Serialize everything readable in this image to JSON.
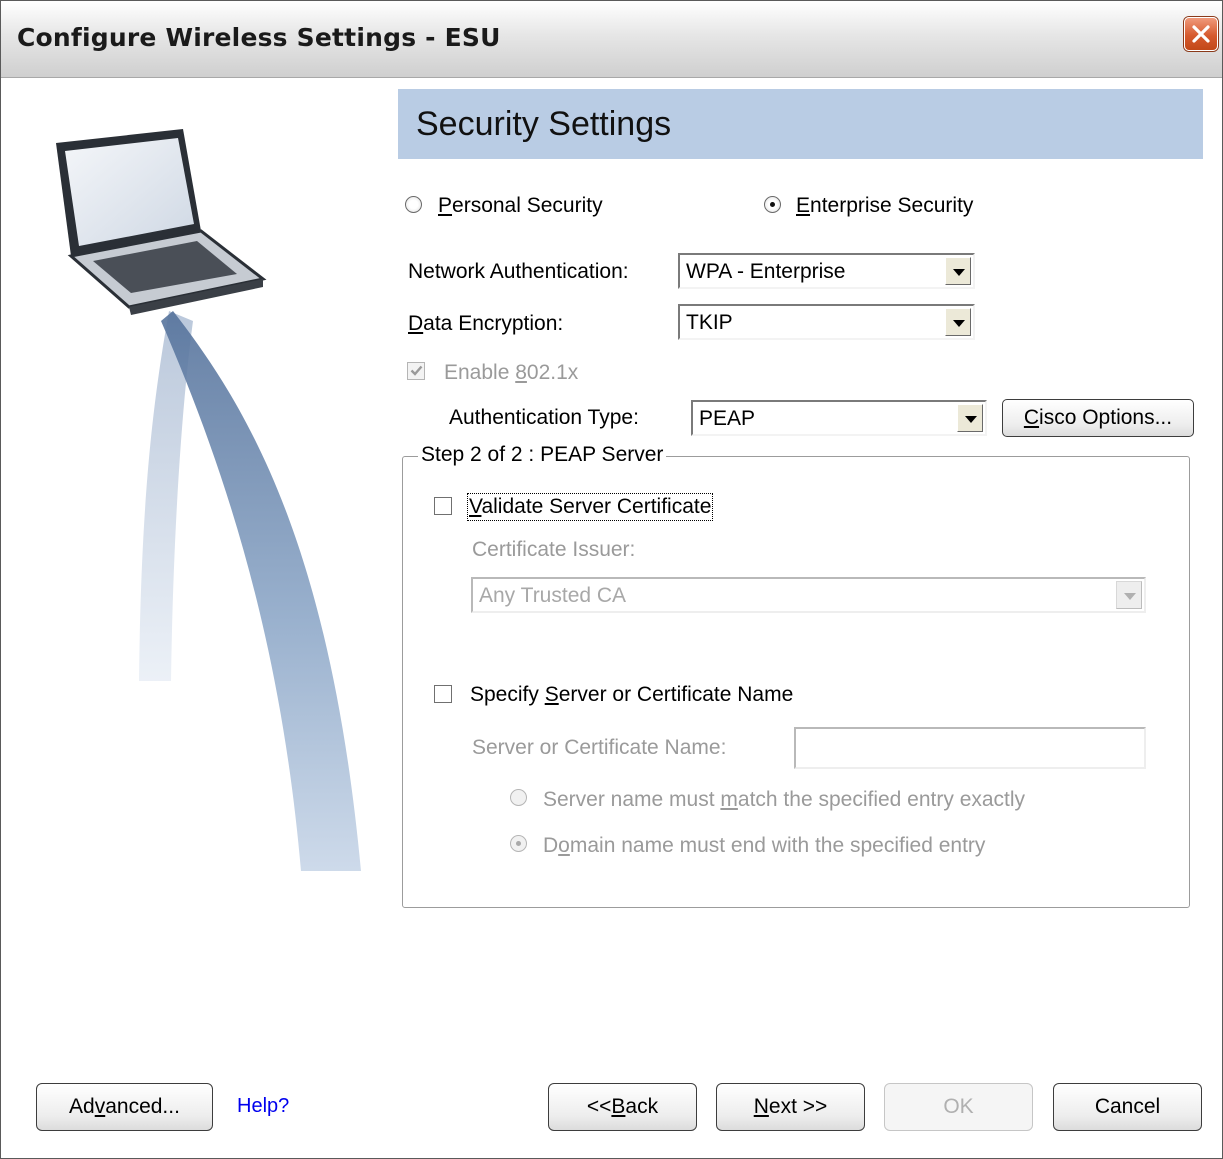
{
  "window": {
    "title": "Configure Wireless Settings - ESU"
  },
  "header": {
    "title": "Security Settings"
  },
  "security_mode": {
    "personal": {
      "label_pre": "",
      "mnemonic": "P",
      "label_post": "ersonal Security",
      "selected": false
    },
    "enterprise": {
      "label_pre": "",
      "mnemonic": "E",
      "label_post": "nterprise Security",
      "selected": true
    }
  },
  "network_auth": {
    "label": "Network Authentication:",
    "value": "WPA - Enterprise"
  },
  "data_encryption": {
    "label_pre": "",
    "mnemonic": "D",
    "label_post": "ata Encryption:",
    "value": "TKIP"
  },
  "enable_8021x": {
    "label_pre": "Enable ",
    "mnemonic": "8",
    "label_post": "02.1x",
    "checked": true,
    "disabled": true
  },
  "auth_type": {
    "label": "Authentication Type:",
    "value": "PEAP"
  },
  "cisco_options": {
    "label_pre": "",
    "mnemonic": "C",
    "label_post": "isco Options..."
  },
  "peap_group": {
    "legend": "Step 2 of 2 : PEAP Server",
    "validate_cert": {
      "label_pre": "",
      "mnemonic": "V",
      "label_post": "alidate Server Certificate",
      "checked": false
    },
    "cert_issuer": {
      "label": "Certificate Issuer:",
      "value": "Any Trusted CA"
    },
    "specify_name": {
      "label_pre": "Specify ",
      "mnemonic": "S",
      "label_post": "erver or Certificate Name",
      "checked": false
    },
    "server_name": {
      "label": "Server or Certificate Name:",
      "value": ""
    },
    "match_exact": {
      "label_pre": "Server name must ",
      "mnemonic": "m",
      "label_post": "atch the specified entry exactly",
      "selected": false
    },
    "domain_end": {
      "label_pre": "D",
      "mnemonic": "o",
      "label_post": "main name must end with the specified entry",
      "selected": true
    }
  },
  "footer": {
    "advanced": {
      "label_pre": "Ad",
      "mnemonic": "v",
      "label_post": "anced..."
    },
    "help": "Help?",
    "back": {
      "label_pre": "<< ",
      "mnemonic": "B",
      "label_post": "ack"
    },
    "next": {
      "label_pre": "",
      "mnemonic": "N",
      "label_post": "ext >>"
    },
    "ok": "OK",
    "cancel": "Cancel"
  },
  "colors": {
    "header_bg": "#b9cce4",
    "close_button": "#d65a2e",
    "link": "#0000ee"
  }
}
